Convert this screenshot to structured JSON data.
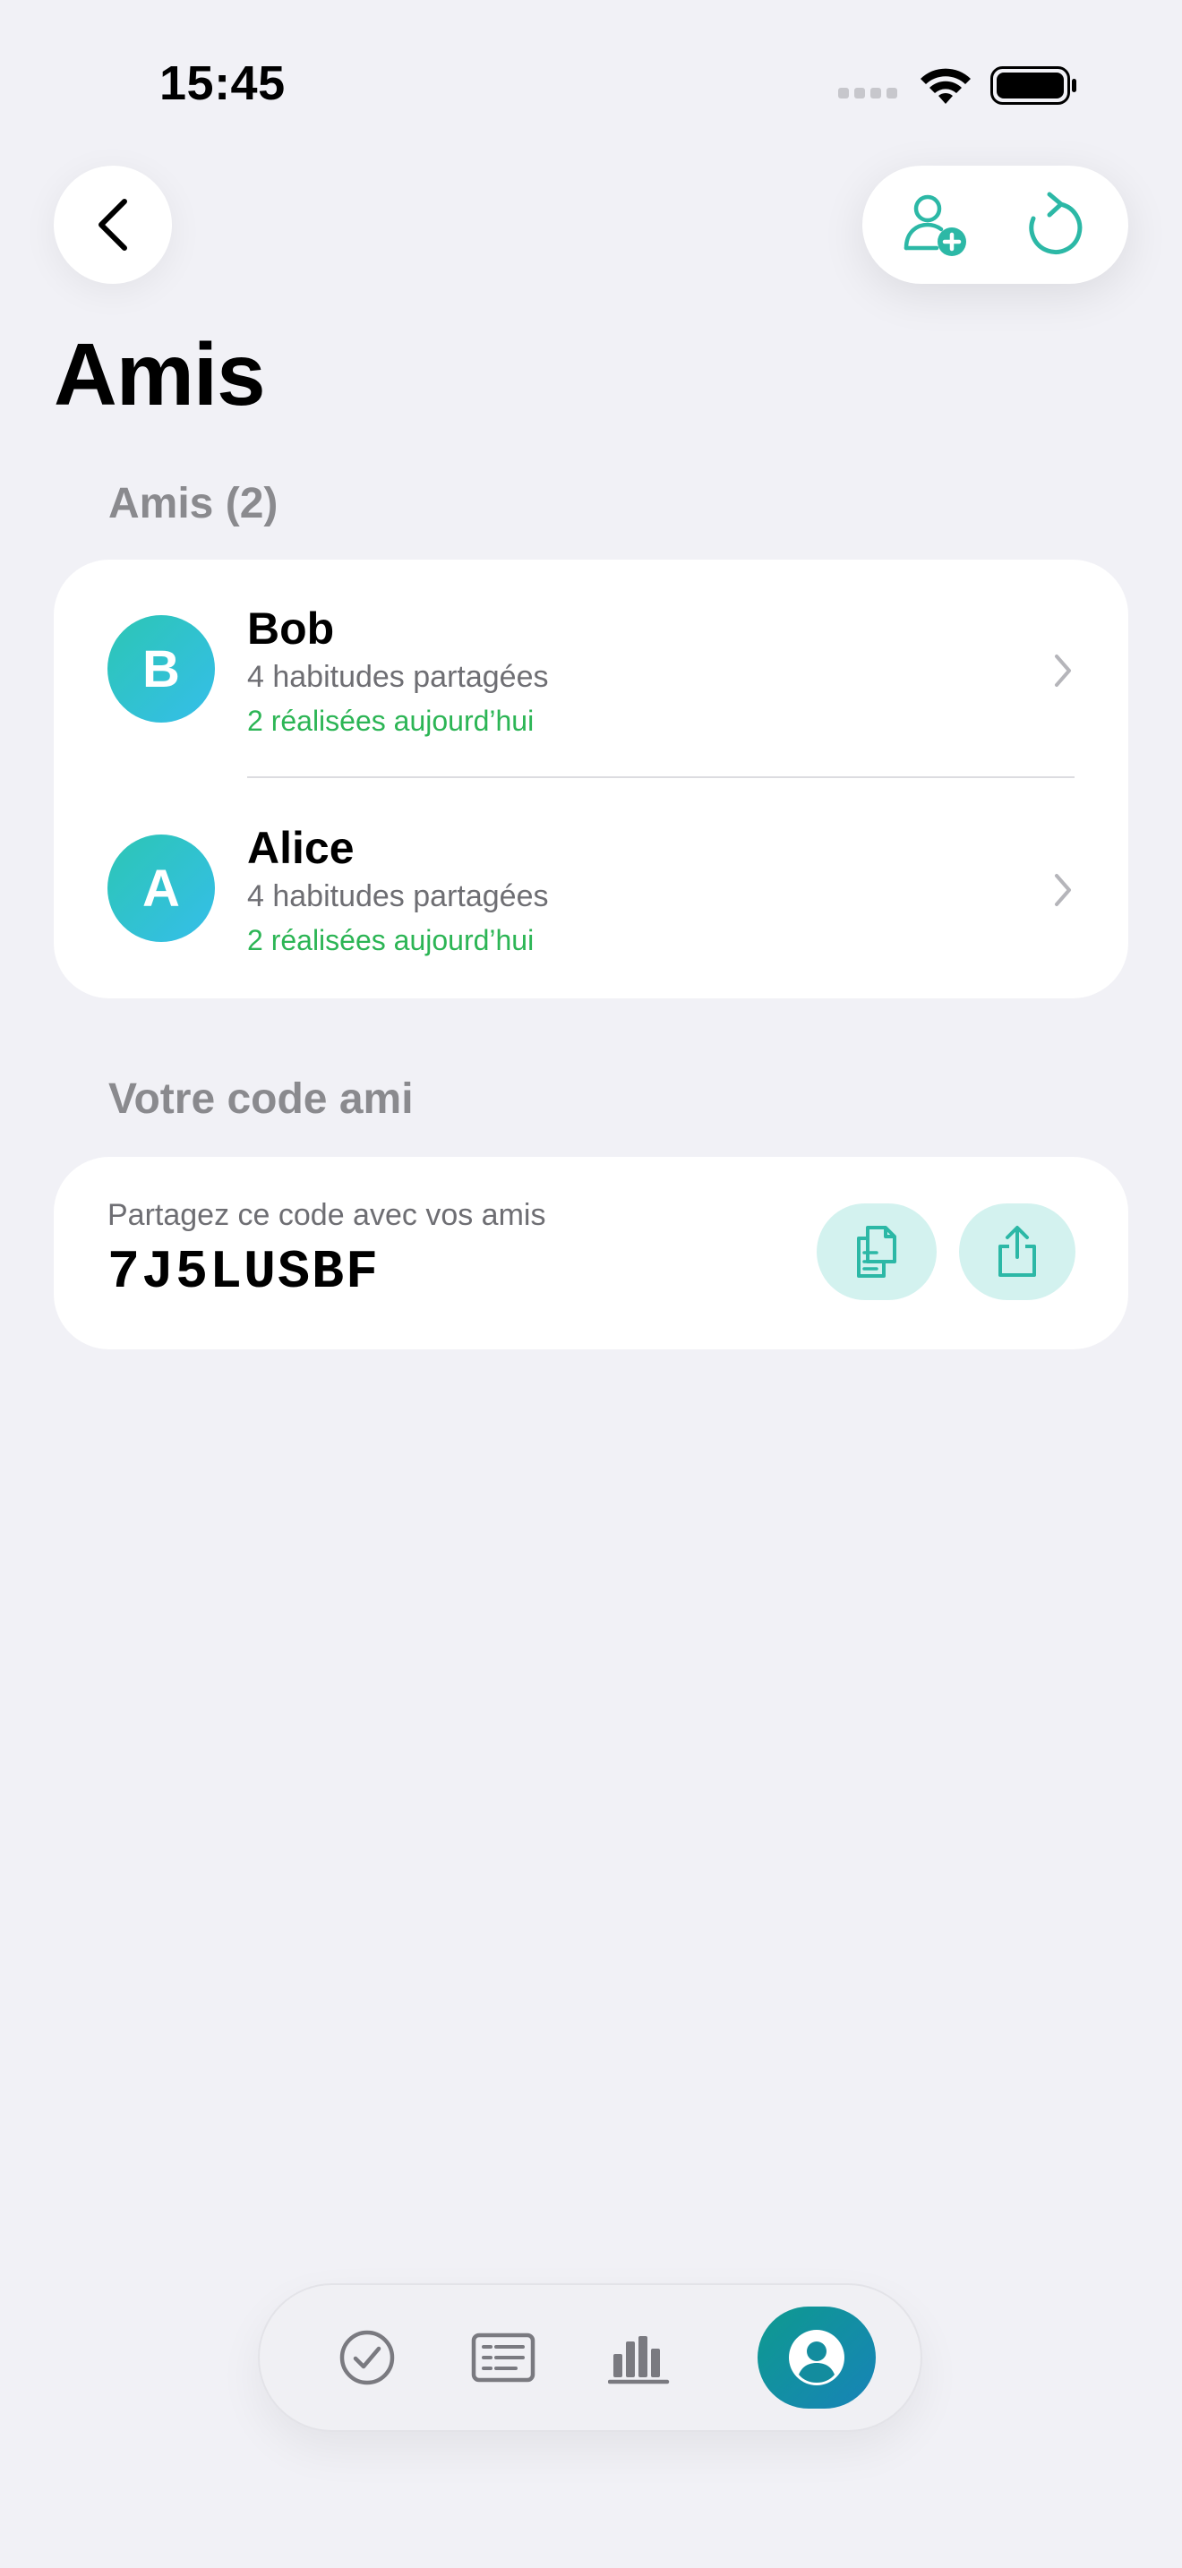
{
  "status_bar": {
    "time": "15:45"
  },
  "nav": {
    "back_icon": "chevron-left-icon",
    "add_friend_icon": "person-add-icon",
    "refresh_icon": "refresh-icon"
  },
  "page": {
    "title": "Amis"
  },
  "friends_section": {
    "header": "Amis (2)",
    "items": [
      {
        "initial": "B",
        "name": "Bob",
        "shared": "4 habitudes partagées",
        "done_today": "2 réalisées aujourd’hui"
      },
      {
        "initial": "A",
        "name": "Alice",
        "shared": "4 habitudes partagées",
        "done_today": "2 réalisées aujourd’hui"
      }
    ]
  },
  "code_section": {
    "header": "Votre code ami",
    "caption": "Partagez ce code avec vos amis",
    "code": "7J5LUSBF"
  },
  "tab_bar": {
    "tabs": [
      {
        "icon": "checkmark-circle-icon",
        "active": false
      },
      {
        "icon": "list-icon",
        "active": false
      },
      {
        "icon": "bar-chart-icon",
        "active": false
      },
      {
        "icon": "profile-icon",
        "active": true
      }
    ]
  },
  "colors": {
    "accent": "#2CB8A6",
    "success_text": "#2CB555",
    "background": "#F1F1F6",
    "avatar_gradient": [
      "#2CC6B4",
      "#35BEEA"
    ],
    "active_tab_gradient": [
      "#0E9A8F",
      "#1783B8"
    ]
  }
}
